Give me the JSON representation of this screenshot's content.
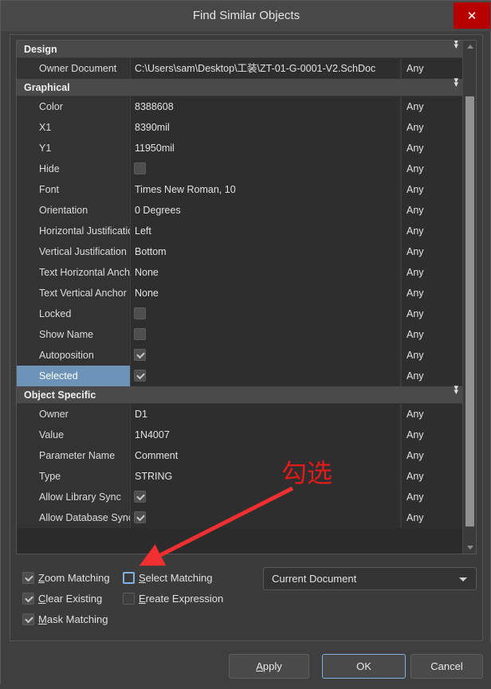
{
  "window": {
    "title": "Find Similar Objects",
    "close_icon": "close-icon",
    "close_glyph": "✕"
  },
  "colors": {
    "accent_blue": "#6d94b8",
    "focus_blue": "#7fb2e0",
    "close_red": "#b60000",
    "annotation_red": "#e01b1b",
    "panel_bg": "#3f3f3f",
    "row_bg": "#333333",
    "value_bg": "#2e2e2e",
    "section_bg": "#4a4a4a"
  },
  "properties": {
    "sections": [
      {
        "name": "Design",
        "collapse_icon": "chevron-double-down-icon",
        "rows": [
          {
            "label": "Owner Document",
            "value": "C:\\Users\\sam\\Desktop\\工装\\ZT-01-G-0001-V2.SchDoc",
            "type": "text",
            "match": "Any",
            "selected": false
          }
        ]
      },
      {
        "name": "Graphical",
        "collapse_icon": "chevron-double-down-icon",
        "rows": [
          {
            "label": "Color",
            "value": "8388608",
            "type": "text",
            "match": "Any",
            "selected": false
          },
          {
            "label": "X1",
            "value": "8390mil",
            "type": "text",
            "match": "Any",
            "selected": false
          },
          {
            "label": "Y1",
            "value": "11950mil",
            "type": "text",
            "match": "Any",
            "selected": false
          },
          {
            "label": "Hide",
            "value": "",
            "type": "checkbox",
            "checked": false,
            "match": "Any",
            "selected": false
          },
          {
            "label": "Font",
            "value": "Times New Roman, 10",
            "type": "text",
            "match": "Any",
            "selected": false
          },
          {
            "label": "Orientation",
            "value": "0 Degrees",
            "type": "text",
            "match": "Any",
            "selected": false
          },
          {
            "label": "Horizontal Justification",
            "value": "Left",
            "type": "text",
            "match": "Any",
            "selected": false
          },
          {
            "label": "Vertical Justification",
            "value": "Bottom",
            "type": "text",
            "match": "Any",
            "selected": false
          },
          {
            "label": "Text Horizontal Anchor",
            "value": "None",
            "type": "text",
            "match": "Any",
            "selected": false
          },
          {
            "label": "Text Vertical Anchor",
            "value": "None",
            "type": "text",
            "match": "Any",
            "selected": false
          },
          {
            "label": "Locked",
            "value": "",
            "type": "checkbox",
            "checked": false,
            "match": "Any",
            "selected": false
          },
          {
            "label": "Show Name",
            "value": "",
            "type": "checkbox",
            "checked": false,
            "match": "Any",
            "selected": false
          },
          {
            "label": "Autoposition",
            "value": "",
            "type": "checkbox",
            "checked": true,
            "match": "Any",
            "selected": false
          },
          {
            "label": "Selected",
            "value": "",
            "type": "checkbox",
            "checked": true,
            "match": "Any",
            "selected": true
          }
        ]
      },
      {
        "name": "Object Specific",
        "collapse_icon": "chevron-double-down-icon",
        "rows": [
          {
            "label": "Owner",
            "value": "D1",
            "type": "text",
            "match": "Any",
            "selected": false
          },
          {
            "label": "Value",
            "value": "1N4007",
            "type": "text",
            "match": "Any",
            "selected": false
          },
          {
            "label": "Parameter Name",
            "value": "Comment",
            "type": "text",
            "match": "Any",
            "selected": false
          },
          {
            "label": "Type",
            "value": "STRING",
            "type": "text",
            "match": "Any",
            "selected": false
          },
          {
            "label": "Allow Library Sync",
            "value": "",
            "type": "checkbox",
            "checked": true,
            "match": "Any",
            "selected": false
          },
          {
            "label": "Allow Database Sync",
            "value": "",
            "type": "checkbox",
            "checked": true,
            "match": "Any",
            "selected": false
          }
        ]
      }
    ]
  },
  "options": {
    "zoom_matching": {
      "label": "Zoom Matching",
      "accesskey": "Z",
      "rest": "oom Matching",
      "checked": true
    },
    "clear_existing": {
      "label": "Clear Existing",
      "accesskey": "C",
      "rest": "lear Existing",
      "checked": true
    },
    "mask_matching": {
      "label": "Mask Matching",
      "accesskey": "M",
      "rest": "ask Matching",
      "checked": true
    },
    "select_matching": {
      "label": "Select Matching",
      "accesskey": "S",
      "rest": "elect Matching",
      "checked": false,
      "focused": true
    },
    "create_expression": {
      "label": "Create Expression",
      "accesskey": "E",
      "rest": "reate Expression",
      "checked": false
    },
    "scope": {
      "value": "Current Document",
      "caret_icon": "chevron-down-icon"
    }
  },
  "footer": {
    "apply": {
      "accesskey": "A",
      "rest": "pply",
      "label": "Apply"
    },
    "ok": {
      "label": "OK",
      "focused": true
    },
    "cancel": {
      "label": "Cancel"
    }
  },
  "annotation": {
    "text": "勾选",
    "arrow_icon": "arrow-pointer-icon"
  }
}
